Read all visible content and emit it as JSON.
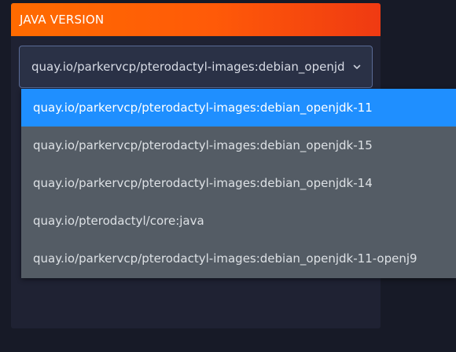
{
  "panel": {
    "title": "JAVA VERSION"
  },
  "select": {
    "value": "quay.io/parkervcp/pterodactyl-images:debian_openjdk-11",
    "icon": "chevron-down-icon"
  },
  "dropdown": {
    "options": [
      {
        "label": "quay.io/parkervcp/pterodactyl-images:debian_openjdk-11",
        "selected": true
      },
      {
        "label": "quay.io/parkervcp/pterodactyl-images:debian_openjdk-15",
        "selected": false
      },
      {
        "label": "quay.io/parkervcp/pterodactyl-images:debian_openjdk-14",
        "selected": false
      },
      {
        "label": "quay.io/pterodactyl/core:java",
        "selected": false
      },
      {
        "label": "quay.io/parkervcp/pterodactyl-images:debian_openjdk-11-openj9",
        "selected": false
      }
    ]
  },
  "colors": {
    "header_start": "#ff6b00",
    "header_end": "#ef3a12",
    "selected_option": "#1f8fff",
    "dropdown_bg": "#545c65"
  }
}
